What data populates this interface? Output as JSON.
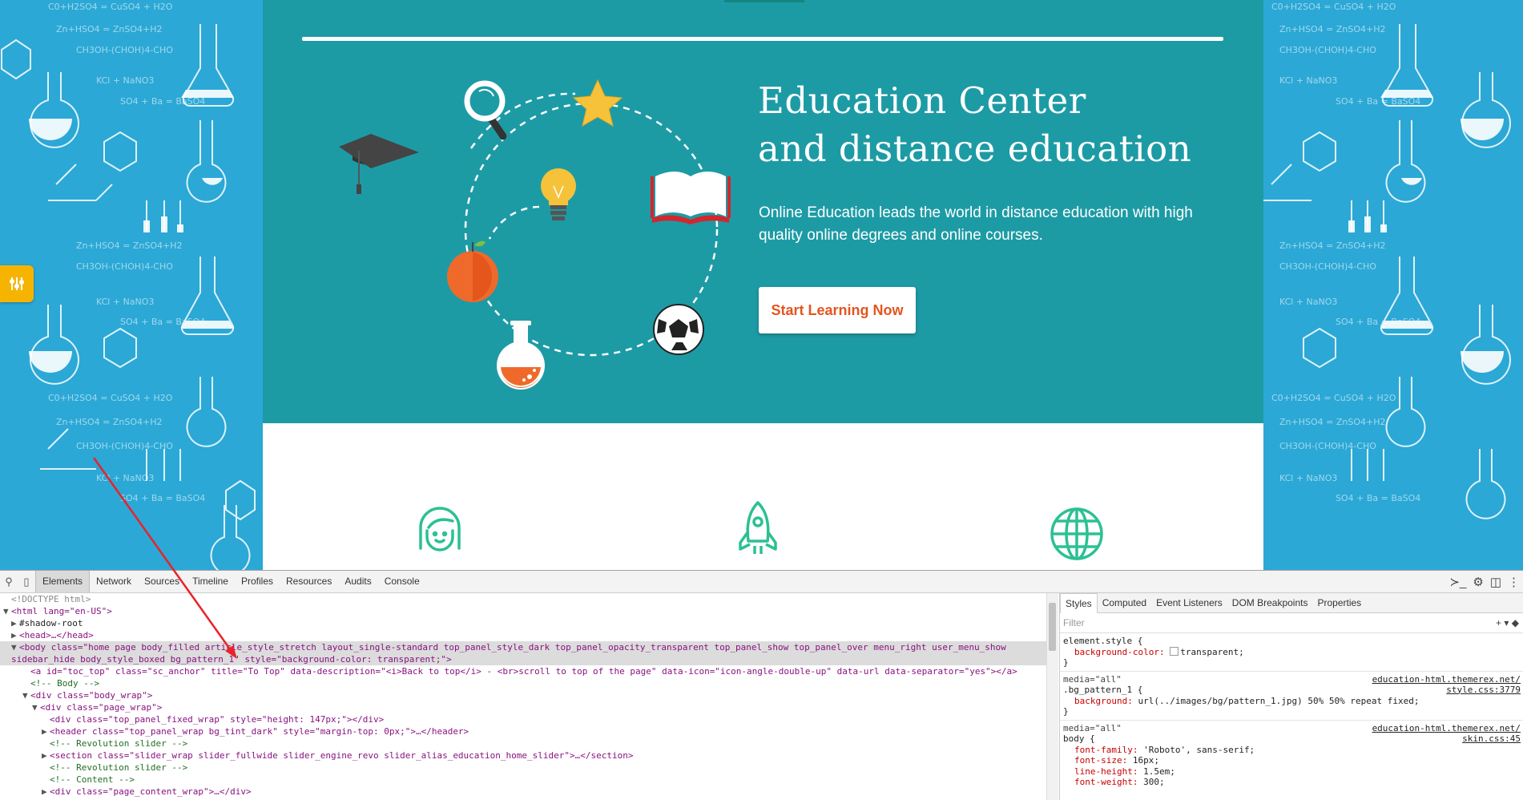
{
  "hero": {
    "title_line1": "Education Center",
    "title_line2": "and distance education",
    "subtitle": "Online Education leads the world in distance education with high quality online degrees and online courses.",
    "cta_label": "Start Learning Now"
  },
  "colors": {
    "pattern_bg": "#2ba8d6",
    "hero_bg": "#1d9ba5",
    "cta_text": "#e4551e",
    "settings_tab": "#f6b400",
    "feature_icon": "#2cc093"
  },
  "features": [
    {
      "icon": "girl-face-icon"
    },
    {
      "icon": "rocket-icon"
    },
    {
      "icon": "globe-icon"
    }
  ],
  "devtools": {
    "tabs": [
      "Elements",
      "Network",
      "Sources",
      "Timeline",
      "Profiles",
      "Resources",
      "Audits",
      "Console"
    ],
    "active_tab": "Elements",
    "dom_lines": [
      "<!DOCTYPE html>",
      "<html lang=\"en-US\">",
      "#shadow-root",
      "<head>…</head>",
      "<body class=\"home page body_filled article_style_stretch layout_single-standard top_panel_style_dark top_panel_opacity_transparent top_panel_show top_panel_over menu_right user_menu_show sidebar_hide body_style_boxed bg_pattern_1\" style=\"background-color: transparent;\">",
      "<a id=\"toc_top\" class=\"sc_anchor\" title=\"To Top\" data-description=\"<i>Back to top</i> - <br>scroll to top of the page\" data-icon=\"icon-angle-double-up\" data-url data-separator=\"yes\"></a>",
      "<!-- Body -->",
      "<div class=\"body_wrap\">",
      "<div class=\"page_wrap\">",
      "<div class=\"top_panel_fixed_wrap\" style=\"height: 147px;\"></div>",
      "<header class=\"top_panel_wrap bg_tint_dark\" style=\"margin-top: 0px;\">…</header>",
      "<!-- Revolution slider -->",
      "<section class=\"slider_wrap slider_fullwide slider_engine_revo slider_alias_education_home_slider\">…</section>",
      "<!-- Revolution slider -->",
      "<!-- Content -->",
      "<div class=\"page_content_wrap\">…</div>"
    ],
    "styles_tabs": [
      "Styles",
      "Computed",
      "Event Listeners",
      "DOM Breakpoints",
      "Properties"
    ],
    "filter_placeholder": "Filter",
    "rules": [
      {
        "selector": "element.style {",
        "source": "",
        "media": "",
        "props": [
          [
            "background-color",
            "transparent;"
          ]
        ]
      },
      {
        "selector": ".bg_pattern_1 {",
        "media": "media=\"all\"",
        "source": "education-html.themerex.net/",
        "source2": "style.css:3779",
        "props": [
          [
            "background",
            "url(../images/bg/pattern_1.jpg) 50% 50% repeat fixed;"
          ]
        ]
      },
      {
        "selector": "body {",
        "media": "media=\"all\"",
        "source": "education-html.themerex.net/",
        "source2": "skin.css:45",
        "props": [
          [
            "font-family",
            "'Roboto', sans-serif;"
          ],
          [
            "font-size",
            "16px;"
          ],
          [
            "line-height",
            "1.5em;"
          ],
          [
            "font-weight",
            "300;"
          ]
        ]
      }
    ],
    "close_brace": "}"
  }
}
